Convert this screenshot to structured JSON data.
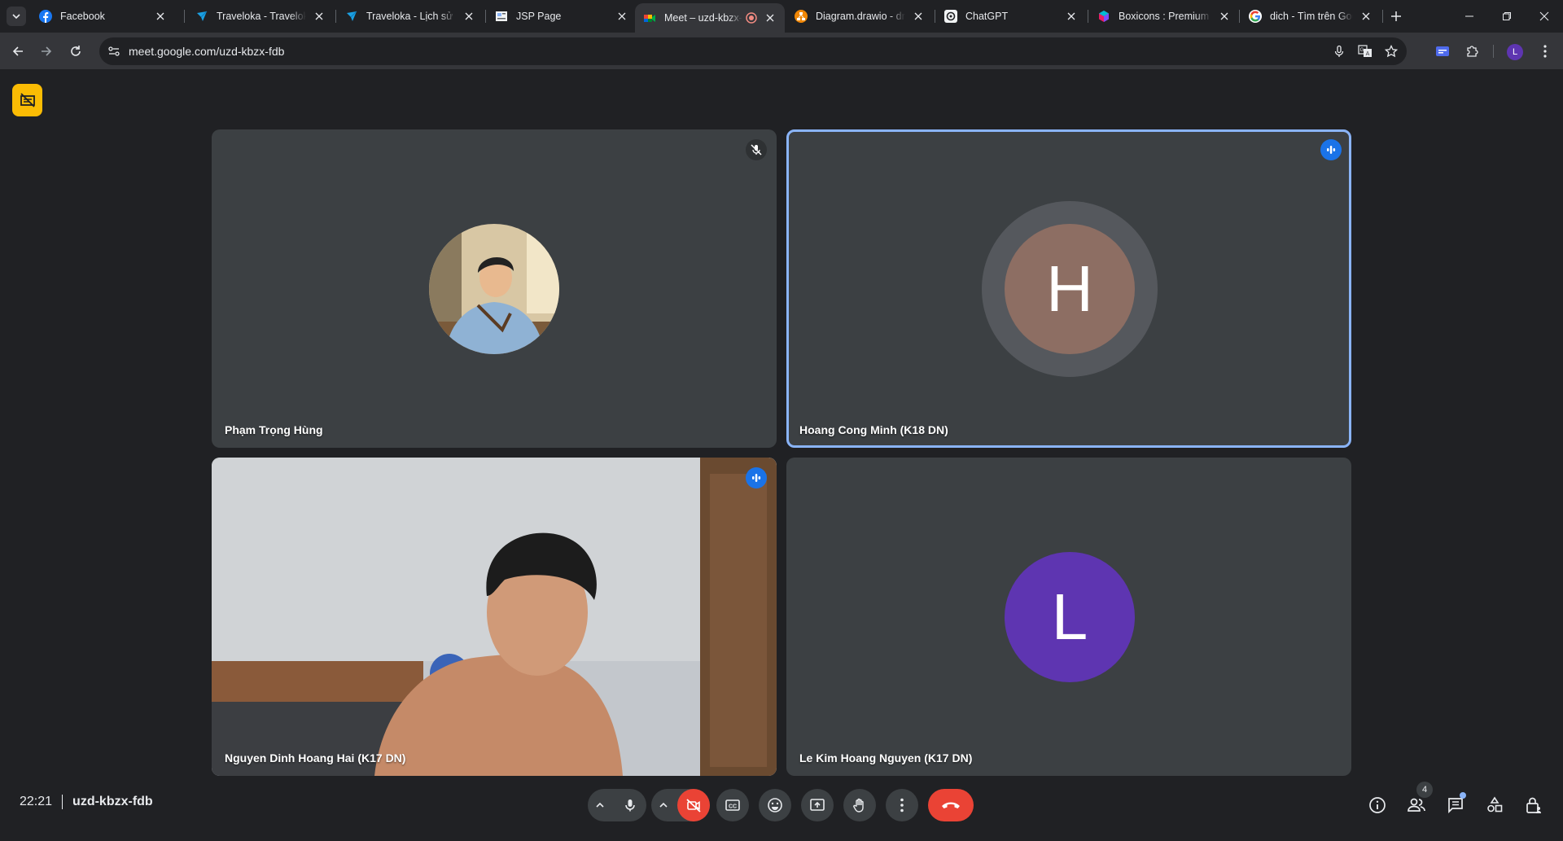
{
  "browser": {
    "tabs": [
      {
        "title": "Facebook",
        "icon": "facebook-icon"
      },
      {
        "title": "Traveloka - Traveloka",
        "icon": "traveloka-icon"
      },
      {
        "title": "Traveloka - Lịch sử đặ",
        "icon": "traveloka-icon"
      },
      {
        "title": "JSP Page",
        "icon": "page-icon"
      },
      {
        "title": "Meet – uzd-kbzx-",
        "icon": "meet-icon",
        "active": true
      },
      {
        "title": "Diagram.drawio - dra",
        "icon": "drawio-icon"
      },
      {
        "title": "ChatGPT",
        "icon": "chatgpt-icon"
      },
      {
        "title": "Boxicons : Premium v",
        "icon": "boxicons-icon"
      },
      {
        "title": "dich - Tìm trên Goog",
        "icon": "google-icon"
      }
    ],
    "url": "meet.google.com/uzd-kbzx-fdb",
    "profile_initial": "L"
  },
  "meet": {
    "participants": [
      {
        "name": "Phạm Trọng Hùng",
        "mic_muted": true
      },
      {
        "name": "Hoang Cong Minh (K18 DN)",
        "initial": "H",
        "color": "#8d6e63",
        "speaking": true
      },
      {
        "name": "Nguyen Dinh Hoang Hai (K17 DN)",
        "camera": true,
        "speaking": true
      },
      {
        "name": "Le Kim Hoang Nguyen (K17 DN)",
        "initial": "L",
        "color": "#5e35b1"
      }
    ],
    "time": "22:21",
    "meeting_code": "uzd-kbzx-fdb",
    "participant_count": "4",
    "colors": {
      "accent": "#8ab4f8",
      "speaking": "#1a73e8",
      "hangup": "#ea4335",
      "camera_off": "#ea4335",
      "notice": "#fbbc04"
    }
  }
}
